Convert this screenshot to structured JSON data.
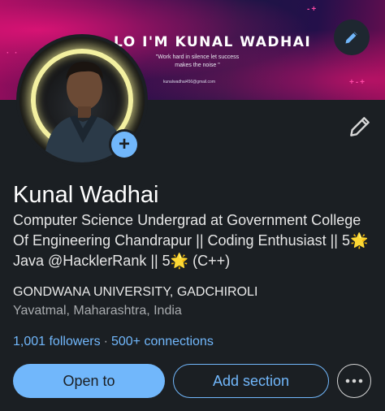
{
  "banner": {
    "title": "LO I'M KUNAL WADHAI",
    "quote": "\"Work hard in silence let success makes the noise \"",
    "email": "kunalwadhai456@gmail.com",
    "edit_icon": "pencil-icon"
  },
  "profile": {
    "name": "Kunal Wadhai",
    "headline": "Computer Science Undergrad at Government College Of Engineering Chandrapur  || Coding Enthusiast || 5🌟 Java @HacklerRank || 5🌟 (C++)",
    "education": "GONDWANA UNIVERSITY, GADCHIROLI",
    "location": "Yavatmal, Maharashtra, India",
    "followers": "1,001 followers",
    "separator": "·",
    "connections": "500+ connections",
    "add_photo_icon": "plus-icon",
    "edit_icon": "pencil-icon"
  },
  "actions": {
    "open_to": "Open to",
    "add_section": "Add section",
    "more_icon": "more-horizontal-icon"
  },
  "colors": {
    "accent": "#71b7fb",
    "background": "#1b1f23"
  }
}
